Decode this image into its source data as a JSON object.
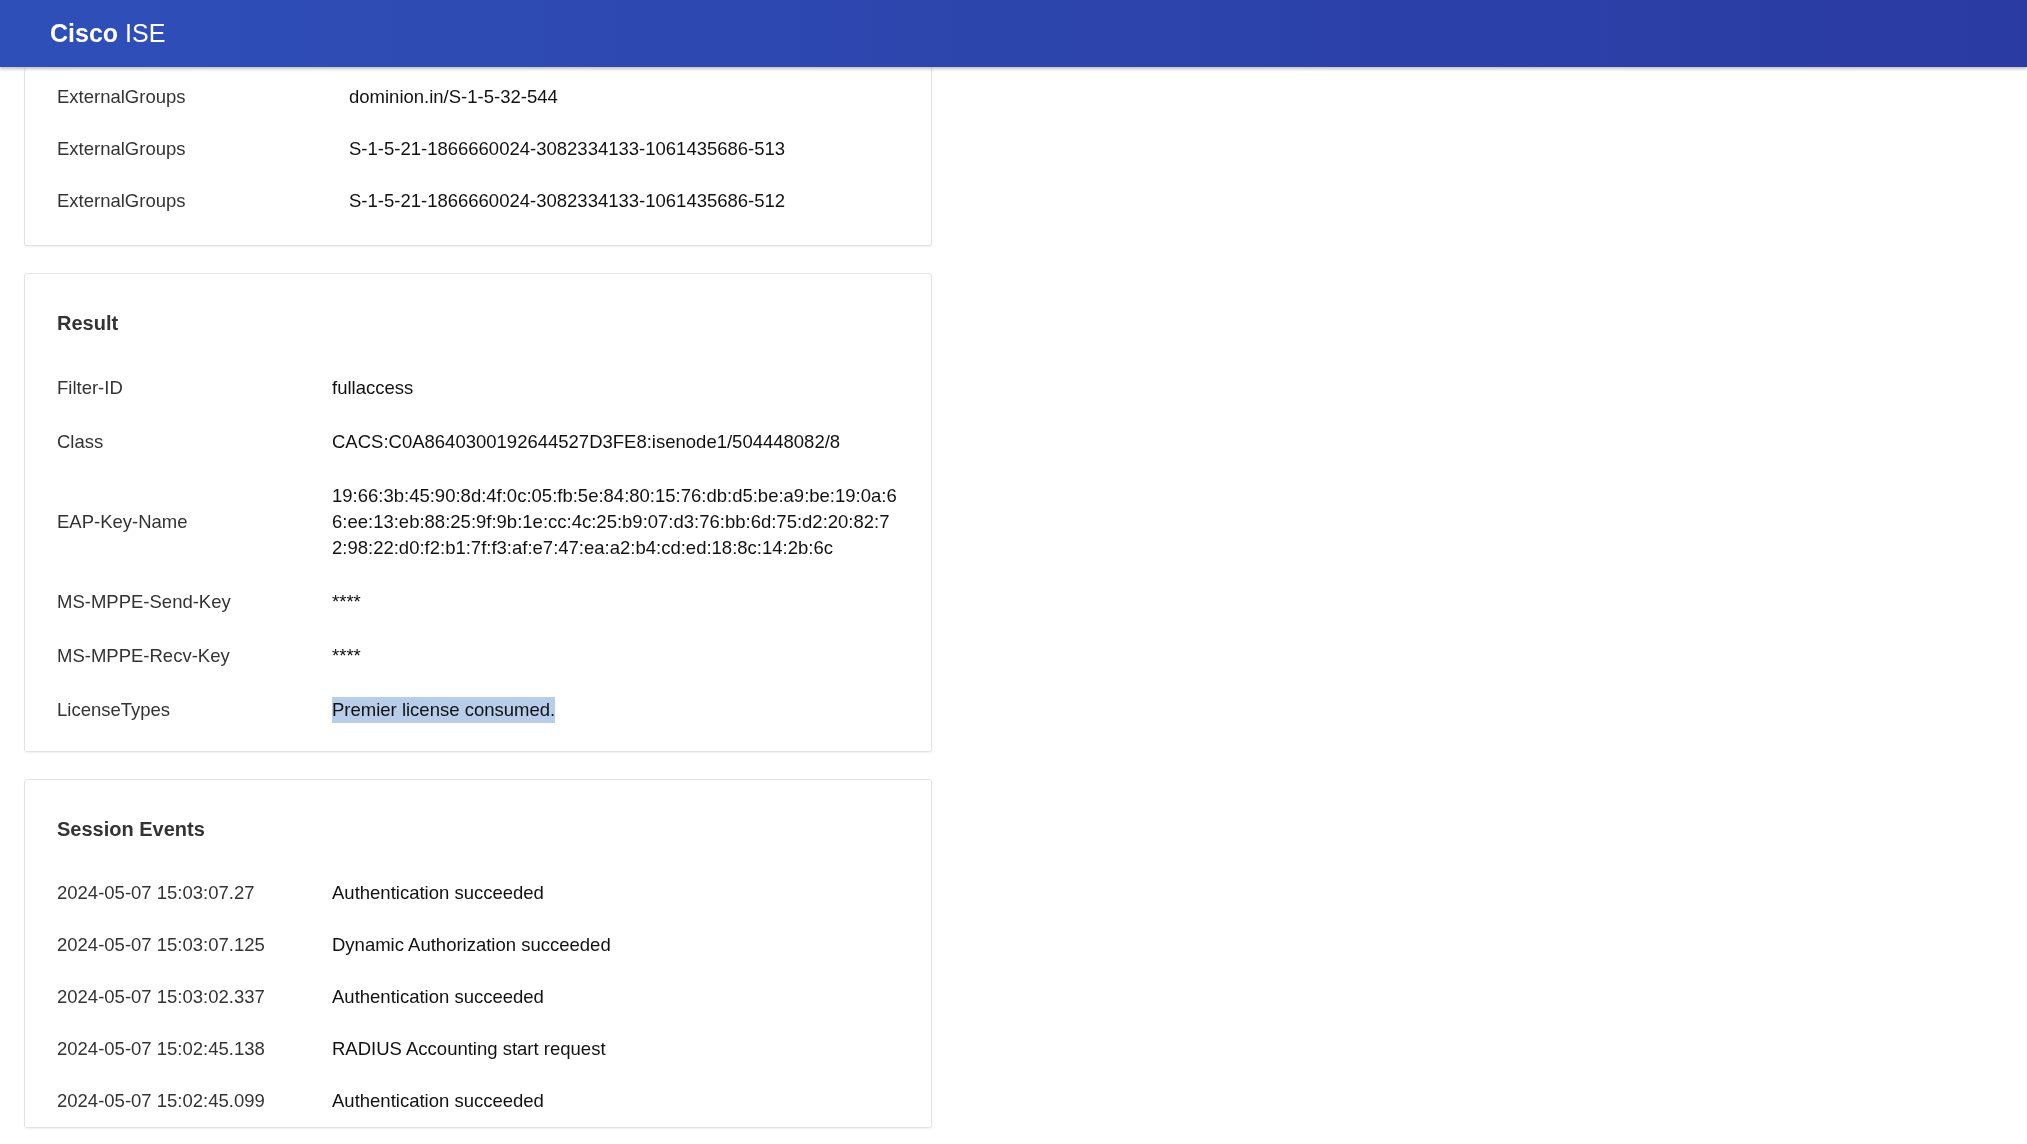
{
  "header": {
    "title": "**Cisco** ISE"
  },
  "groups_card": {
    "rows": [
      {
        "label": "ExternalGroups",
        "value": "dominion.in/S-1-5-32-544"
      },
      {
        "label": "ExternalGroups",
        "value": "S-1-5-21-1866660024-3082334133-1061435686-513"
      },
      {
        "label": "ExternalGroups",
        "value": "S-1-5-21-1866660024-3082334133-1061435686-512"
      }
    ]
  },
  "result": {
    "title": "Result",
    "rows": [
      {
        "label": "Filter-ID",
        "value": "fullaccess",
        "highlighted": false
      },
      {
        "label": "Class",
        "value": "CACS:C0A8640300192644527D3FE8:isenode1/504448082/8",
        "highlighted": false
      },
      {
        "label": "EAP-Key-Name",
        "value": "19:66:3b:45:90:8d:4f:0c:05:fb:5e:84:80:15:76:db:d5:be:a9:be:19:0a:66:ee:13:eb:88:25:9f:9b:1e:cc:4c:25:b9:07:d3:76:bb:6d:75:d2:20:82:72:98:22:d0:f2:b1:7f:f3:af:e7:47:ea:a2:b4:cd:ed:18:8c:14:2b:6c",
        "highlighted": false
      },
      {
        "label": "MS-MPPE-Send-Key",
        "value": "****",
        "highlighted": false
      },
      {
        "label": "MS-MPPE-Recv-Key",
        "value": "****",
        "highlighted": false
      },
      {
        "label": "LicenseTypes",
        "value": "Premier license consumed.",
        "highlighted": true
      }
    ]
  },
  "session_events": {
    "title": "Session Events",
    "rows": [
      {
        "time": "2024-05-07 15:03:07.27",
        "event": "Authentication succeeded"
      },
      {
        "time": "2024-05-07 15:03:07.125",
        "event": "Dynamic Authorization succeeded"
      },
      {
        "time": "2024-05-07 15:03:02.337",
        "event": "Authentication succeeded"
      },
      {
        "time": "2024-05-07 15:02:45.138",
        "event": "RADIUS Accounting start request"
      },
      {
        "time": "2024-05-07 15:02:45.099",
        "event": "Authentication succeeded"
      }
    ]
  }
}
